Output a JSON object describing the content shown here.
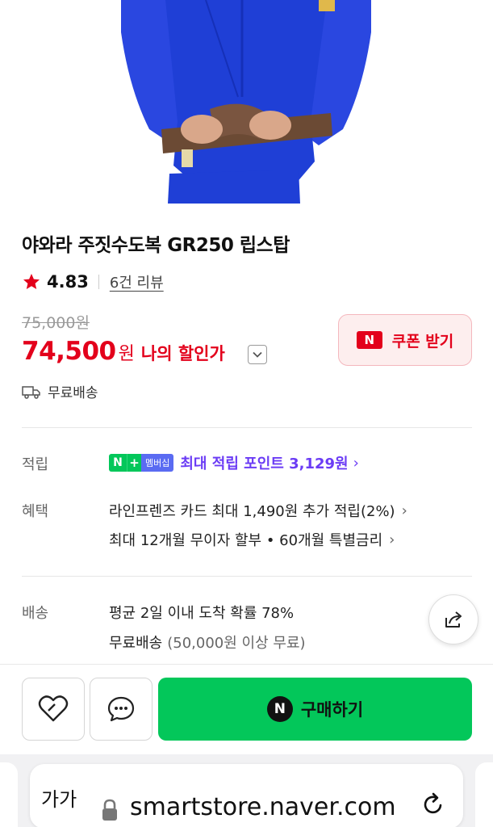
{
  "product": {
    "title": "야와라 주짓수도복 GR250 립스탑",
    "rating": "4.83",
    "review_link": "6건 리뷰",
    "original_price": "75,000원",
    "sale_price": "74,500",
    "sale_unit": "원",
    "discount_label": "나의 할인가",
    "coupon_n": "N",
    "coupon_label": "쿠폰 받기",
    "shipping_label": "무료배송"
  },
  "details": {
    "points": {
      "label": "적립",
      "badge_n": "N",
      "badge_plus": "+",
      "badge_text": "멤버십",
      "text": "최대 적립 포인트 3,129원",
      "chevron": "›"
    },
    "benefits": {
      "label": "혜택",
      "lines": [
        {
          "text": "라인프렌즈 카드 최대 1,490원 추가 적립(2%)",
          "chevron": "›"
        },
        {
          "text": "최대 12개월 무이자 할부 • 60개월 특별금리",
          "chevron": "›"
        }
      ]
    },
    "delivery": {
      "label": "배송",
      "line1": "평균 2일 이내 도착 확률 78%",
      "line2_main": "무료배송",
      "line2_note": "(50,000원 이상 무료)"
    }
  },
  "buy_bar": {
    "buy_n": "N",
    "buy_label": "구매하기"
  },
  "browser": {
    "aa_label": "가가",
    "url": "smartstore.naver.com"
  },
  "colors": {
    "price_red": "#e3001b",
    "naver_green": "#03c75a",
    "points_purple": "#6b3cf5",
    "gi_blue": "#1f3fd6"
  },
  "icons": [
    "star-icon",
    "chevron-down-icon",
    "truck-icon",
    "share-icon",
    "heart-icon",
    "chat-icon",
    "lock-icon",
    "reload-icon"
  ]
}
